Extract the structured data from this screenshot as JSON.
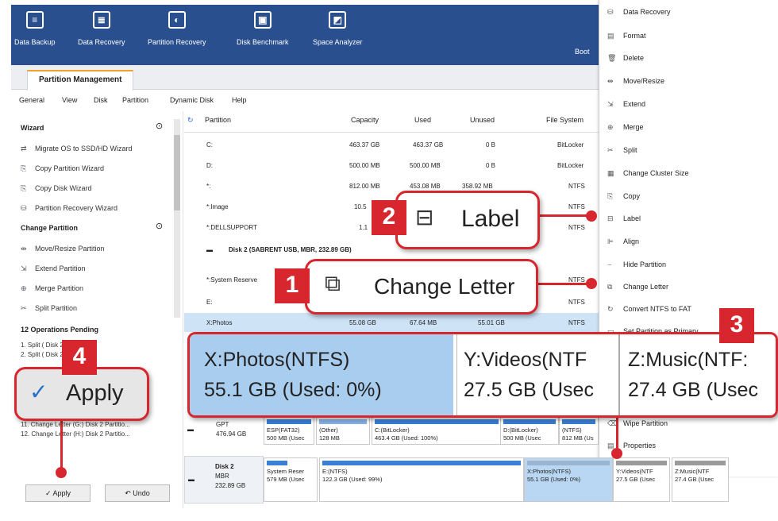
{
  "toolbar": {
    "items": [
      {
        "label": "Data Backup",
        "icon": "backup-icon"
      },
      {
        "label": "Data Recovery",
        "icon": "data-recovery-icon"
      },
      {
        "label": "Partition Recovery",
        "icon": "partition-recovery-icon"
      },
      {
        "label": "Disk Benchmark",
        "icon": "disk-benchmark-icon"
      },
      {
        "label": "Space Analyzer",
        "icon": "space-analyzer-icon"
      },
      {
        "label": "Boot"
      }
    ]
  },
  "tab": {
    "label": "Partition Management"
  },
  "menu": [
    "General",
    "View",
    "Disk",
    "Partition",
    "Dynamic Disk",
    "Help"
  ],
  "left": {
    "wizard_title": "Wizard",
    "wizard_items": [
      "Migrate OS to SSD/HD Wizard",
      "Copy Partition Wizard",
      "Copy Disk Wizard",
      "Partition Recovery Wizard"
    ],
    "change_title": "Change Partition",
    "change_items": [
      "Move/Resize Partition",
      "Extend Partition",
      "Merge Partition",
      "Split Partition"
    ],
    "ops_title": "12 Operations Pending",
    "ops": [
      "1. Split ( Disk 2 Partition 2)",
      "2. Split ( Disk 2 Partition 3)",
      "11. Change Letter (G:) Disk 2 Partitio...",
      "12. Change Letter (H:) Disk 2 Partitio..."
    ],
    "apply_label": "Apply",
    "undo_label": "Undo"
  },
  "table": {
    "headers": [
      "Partition",
      "Capacity",
      "Used",
      "Unused",
      "File System"
    ],
    "rows": [
      {
        "name": "C:",
        "capacity": "463.37 GB",
        "used": "463.37 GB",
        "unused": "0 B",
        "fs": "BitLocker"
      },
      {
        "name": "D:",
        "capacity": "500.00 MB",
        "used": "500.00 MB",
        "unused": "0 B",
        "fs": "BitLocker"
      },
      {
        "name": "*:",
        "capacity": "812.00 MB",
        "used": "453.08 MB",
        "unused": "358.92 MB",
        "fs": "NTFS"
      },
      {
        "name": "*:Image",
        "capacity": "10.5",
        "used": "",
        "unused": "",
        "fs": "NTFS"
      },
      {
        "name": "*:DELLSUPPORT",
        "capacity": "1.1",
        "used": "",
        "unused": "",
        "fs": "NTFS"
      },
      {
        "name": "Disk 2 (SABRENT USB, MBR, 232.89 GB)",
        "capacity": "",
        "used": "",
        "unused": "",
        "fs": ""
      },
      {
        "name": "*:System Reserve",
        "capacity": "",
        "used": "",
        "unused": "",
        "fs": "NTFS"
      },
      {
        "name": "E:",
        "capacity": "",
        "used": "",
        "unused": "",
        "fs": "NTFS"
      },
      {
        "name": "X:Photos",
        "capacity": "55.08 GB",
        "used": "67.64 MB",
        "unused": "55.01 GB",
        "fs": "NTFS"
      }
    ]
  },
  "context_menu": [
    "Data Recovery",
    "Format",
    "Delete",
    "Move/Resize",
    "Extend",
    "Merge",
    "Split",
    "Change Cluster Size",
    "Copy",
    "Label",
    "Align",
    "Hide Partition",
    "Change Letter",
    "Convert NTFS to FAT",
    "Set Partition as Primary",
    "Wipe Partition",
    "Properties"
  ],
  "disks": {
    "disk1": {
      "name": "GPT",
      "size": "476.94 GB",
      "parts": [
        {
          "l1": "ESP(FAT32)",
          "l2": "500 MB (Usec"
        },
        {
          "l1": "(Other)",
          "l2": "128 MB"
        },
        {
          "l1": "C:(BitLocker)",
          "l2": "463.4 GB (Used: 100%)"
        },
        {
          "l1": "D:(BitLocker)",
          "l2": "500 MB (Usec"
        },
        {
          "l1": "(NTFS)",
          "l2": "812 MB (Us"
        }
      ]
    },
    "disk2": {
      "name": "Disk 2",
      "type": "MBR",
      "size": "232.89 GB",
      "parts": [
        {
          "l1": "System Reser",
          "l2": "579 MB (Usec"
        },
        {
          "l1": "E:(NTFS)",
          "l2": "122.3 GB (Used: 99%)"
        },
        {
          "l1": "X:Photos(NTFS)",
          "l2": "55.1 GB (Used: 0%)"
        },
        {
          "l1": "Y:Videos(NTF",
          "l2": "27.5 GB (Usec"
        },
        {
          "l1": "Z:Music(NTF",
          "l2": "27.4 GB (Usec"
        }
      ]
    }
  },
  "callouts": {
    "c1": {
      "number": "1",
      "label": "Change Letter"
    },
    "c2": {
      "number": "2",
      "label": "Label"
    },
    "c3": {
      "number": "3"
    },
    "c4": {
      "number": "4",
      "label": "Apply"
    },
    "zoom": [
      {
        "l1": "X:Photos(NTFS)",
        "l2": "55.1 GB (Used: 0%)"
      },
      {
        "l1": "Y:Videos(NTF",
        "l2": "27.5 GB (Usec"
      },
      {
        "l1": "Z:Music(NTF:",
        "l2": "27.4 GB (Usec"
      }
    ]
  },
  "colors": {
    "accent": "#d7262d",
    "toolbar": "#2a4f8f",
    "selection": "#cfe3f7"
  }
}
